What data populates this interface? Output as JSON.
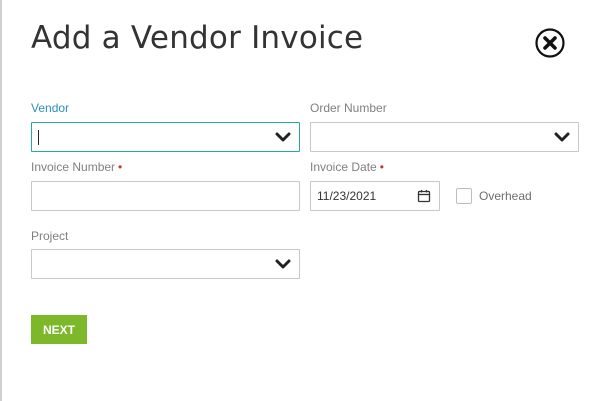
{
  "dialog": {
    "title": "Add a Vendor Invoice",
    "close_icon": "close-icon"
  },
  "form": {
    "vendor": {
      "label": "Vendor",
      "value": ""
    },
    "order_number": {
      "label": "Order Number",
      "value": ""
    },
    "invoice_number": {
      "label": "Invoice Number",
      "required_marker": "•",
      "value": ""
    },
    "invoice_date": {
      "label": "Invoice Date",
      "required_marker": "•",
      "value": "11/23/2021",
      "icon": "calendar-icon"
    },
    "overhead": {
      "label": "Overhead",
      "checked": false
    },
    "project": {
      "label": "Project",
      "value": ""
    }
  },
  "actions": {
    "next_label": "NEXT"
  },
  "colors": {
    "accent_label": "#2b8fbf",
    "focus_border": "#2aa8a0",
    "required": "#c0392b",
    "next_button": "#7db82a",
    "title_text": "#333333"
  }
}
